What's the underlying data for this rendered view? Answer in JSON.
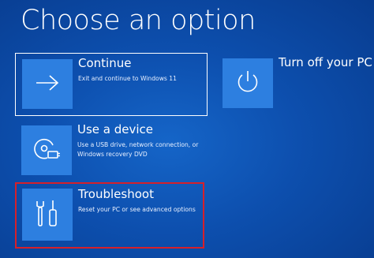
{
  "page": {
    "title": "Choose an option"
  },
  "options": {
    "continue": {
      "title": "Continue",
      "description": "Exit and continue to Windows 11",
      "icon": "arrow-right-icon"
    },
    "use_device": {
      "title": "Use a device",
      "description_line1": "Use a USB drive, network connection, or",
      "description_line2": "Windows recovery DVD",
      "icon": "disc-device-icon"
    },
    "troubleshoot": {
      "title": "Troubleshoot",
      "description": "Reset your PC or see advanced options",
      "icon": "tools-icon",
      "highlighted": true,
      "highlight_color": "#d6202a"
    },
    "turn_off": {
      "title": "Turn off your PC",
      "icon": "power-icon"
    }
  },
  "colors": {
    "background": "#0d4fae",
    "tile": "#2d7fe0",
    "text": "#ffffff"
  }
}
